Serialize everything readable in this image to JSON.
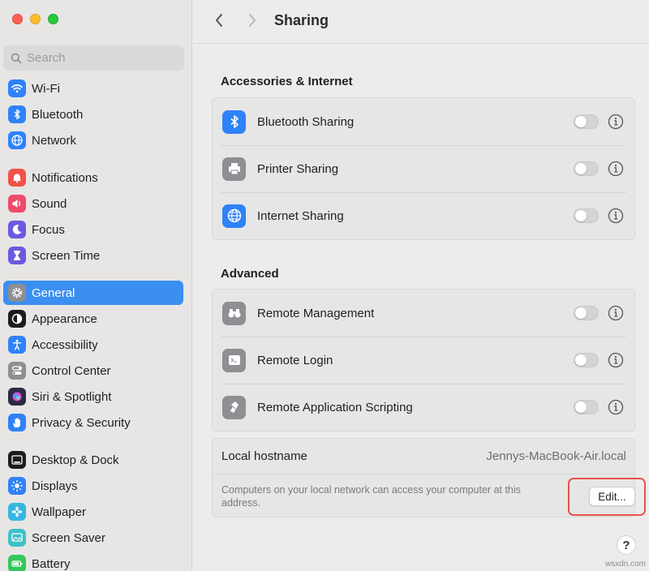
{
  "window": {
    "traffic_lights": [
      "close",
      "minimize",
      "zoom"
    ],
    "colors": {
      "close": "#fe5f57",
      "minimize": "#febc2e",
      "zoom": "#28c840"
    }
  },
  "sidebar": {
    "search_placeholder": "Search",
    "active_color": "#3b8ff0",
    "items": [
      {
        "label": "Wi-Fi",
        "icon": "wifi-icon",
        "color": "#2f82f7"
      },
      {
        "label": "Bluetooth",
        "icon": "bluetooth-icon",
        "color": "#2f82f7"
      },
      {
        "label": "Network",
        "icon": "globe-icon",
        "color": "#2f82f7"
      },
      {
        "label": "Notifications",
        "icon": "bell-icon",
        "color": "#f0524a"
      },
      {
        "label": "Sound",
        "icon": "speaker-icon",
        "color": "#f04a6a"
      },
      {
        "label": "Focus",
        "icon": "moon-icon",
        "color": "#6a5ae0"
      },
      {
        "label": "Screen Time",
        "icon": "hourglass-icon",
        "color": "#6a5ae0"
      },
      {
        "label": "General",
        "icon": "gear-icon",
        "color": "#8e8e93",
        "active": true
      },
      {
        "label": "Appearance",
        "icon": "appearance-icon",
        "color": "#1c1c1e"
      },
      {
        "label": "Accessibility",
        "icon": "accessibility-icon",
        "color": "#2f82f7"
      },
      {
        "label": "Control Center",
        "icon": "toggles-icon",
        "color": "#8e8e93"
      },
      {
        "label": "Siri & Spotlight",
        "icon": "siri-icon",
        "color": "#2a2a44"
      },
      {
        "label": "Privacy & Security",
        "icon": "hand-icon",
        "color": "#2f82f7"
      },
      {
        "label": "Desktop & Dock",
        "icon": "dock-icon",
        "color": "#1c1c1e"
      },
      {
        "label": "Displays",
        "icon": "sun-icon",
        "color": "#2f82f7"
      },
      {
        "label": "Wallpaper",
        "icon": "flower-icon",
        "color": "#35b6e0"
      },
      {
        "label": "Screen Saver",
        "icon": "screensaver-icon",
        "color": "#40c0c8"
      },
      {
        "label": "Battery",
        "icon": "battery-icon",
        "color": "#34c759"
      }
    ]
  },
  "toolbar": {
    "back_icon": "chevron-left-icon",
    "forward_icon": "chevron-right-icon",
    "title": "Sharing"
  },
  "accessories": {
    "title": "Accessories & Internet",
    "rows": [
      {
        "label": "Bluetooth Sharing",
        "icon": "bluetooth-icon",
        "color": "#2f82f7",
        "enabled": false
      },
      {
        "label": "Printer Sharing",
        "icon": "printer-icon",
        "color": "#8e8e93",
        "enabled": false
      },
      {
        "label": "Internet Sharing",
        "icon": "globe-icon",
        "color": "#2f82f7",
        "enabled": false
      }
    ]
  },
  "advanced": {
    "title": "Advanced",
    "rows": [
      {
        "label": "Remote Management",
        "icon": "binoculars-icon",
        "color": "#8e8e93",
        "enabled": false
      },
      {
        "label": "Remote Login",
        "icon": "terminal-icon",
        "color": "#8e8e93",
        "enabled": false
      },
      {
        "label": "Remote Application Scripting",
        "icon": "script-icon",
        "color": "#8e8e93",
        "enabled": false
      }
    ]
  },
  "hostname": {
    "label": "Local hostname",
    "value": "Jennys-MacBook-Air.local",
    "description": "Computers on your local network can access your computer at this address.",
    "edit_label": "Edit...",
    "highlight_color": "#e5534b"
  },
  "help_label": "?",
  "watermark": "wsxdn.com"
}
